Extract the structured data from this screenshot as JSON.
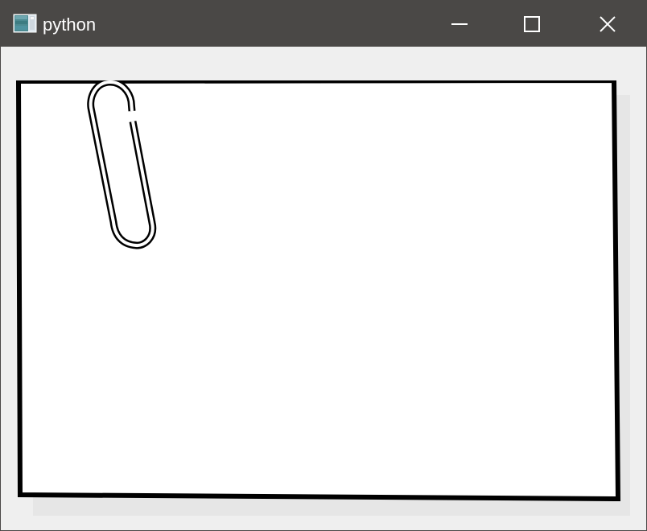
{
  "window": {
    "title": "python",
    "controls": {
      "minimize": "minimize-icon",
      "maximize": "maximize-icon",
      "close": "close-icon"
    },
    "colors": {
      "titlebar": "#4a4846",
      "background": "#efefef",
      "paper": "#ffffff",
      "border": "#000000",
      "shadow": "#e6e6e6"
    }
  },
  "content": {
    "note_icon": "paper-clip-note-icon"
  }
}
